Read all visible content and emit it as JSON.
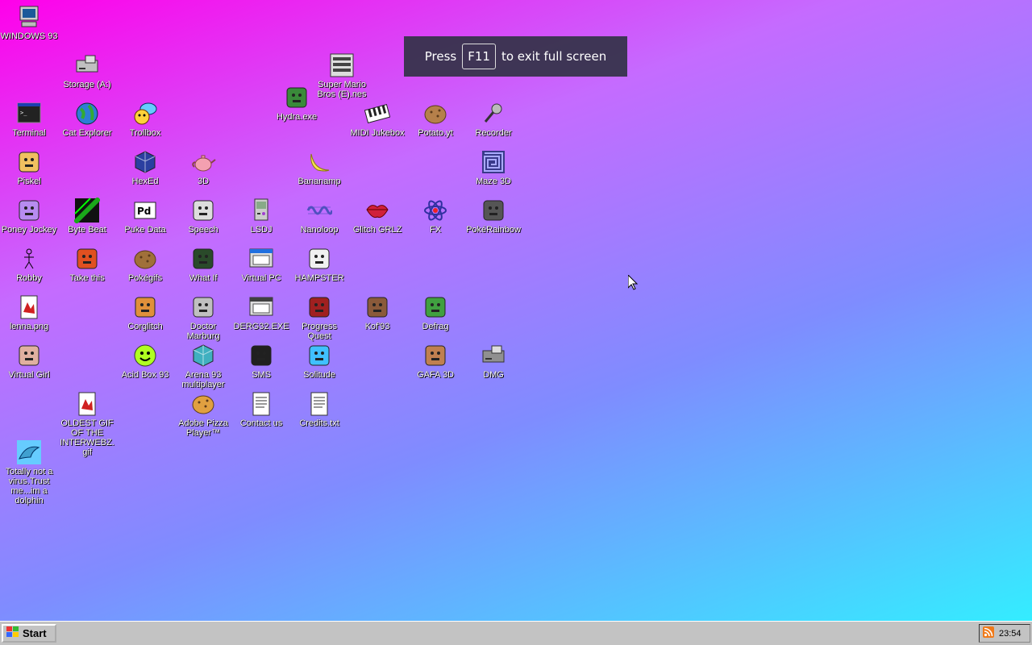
{
  "desktop": {
    "icons": [
      {
        "label": "WINDOWS 93",
        "icon": "computer-icon",
        "color": "#808080"
      },
      {
        "label": "Storage (A:)",
        "icon": "floppy-drive-icon",
        "color": "#c0c0c0"
      },
      {
        "label": "Super Mario Bros (E).nes",
        "icon": "nes-console-icon",
        "color": "#d0d0d0"
      },
      {
        "label": "Hydra.exe",
        "icon": "hydra-icon",
        "color": "#3a8a3a"
      },
      {
        "label": "Terminal",
        "icon": "terminal-icon",
        "color": "#000000"
      },
      {
        "label": "Cat Explorer",
        "icon": "globe-icon",
        "color": "#2e7dd6"
      },
      {
        "label": "Trollbox",
        "icon": "chat-icon",
        "color": "#ffd23a"
      },
      {
        "label": "MIDI Jukebox",
        "icon": "piano-icon",
        "color": "#222222"
      },
      {
        "label": "Potato.yt",
        "icon": "potato-icon",
        "color": "#b5804a"
      },
      {
        "label": "Recorder",
        "icon": "microphone-icon",
        "color": "#888888"
      },
      {
        "label": "Piskel",
        "icon": "palette-icon",
        "color": "#f0c060"
      },
      {
        "label": "HexEd",
        "icon": "cube-icon",
        "color": "#2b3fa0"
      },
      {
        "label": "3D",
        "icon": "teapot-icon",
        "color": "#f3a0b0"
      },
      {
        "label": "Bananamp",
        "icon": "banana-icon",
        "color": "#f5e050"
      },
      {
        "label": "Maze 3D",
        "icon": "maze-icon",
        "color": "#3a3a8a"
      },
      {
        "label": "Poney Jockey",
        "icon": "pony-icon",
        "color": "#b78cf0"
      },
      {
        "label": "Byte Beat",
        "icon": "byte-beat-icon",
        "color": "#1aa81a"
      },
      {
        "label": "Puke Data",
        "icon": "pd-icon",
        "color": "#ffffff"
      },
      {
        "label": "Speech",
        "icon": "face-icon",
        "color": "#dddddd"
      },
      {
        "label": "LSDJ",
        "icon": "gameboy-icon",
        "color": "#a040d0"
      },
      {
        "label": "Nanoloop",
        "icon": "wave-icon",
        "color": "#5050c0"
      },
      {
        "label": "Glitch GRLZ",
        "icon": "lips-icon",
        "color": "#d0203a"
      },
      {
        "label": "FX",
        "icon": "atom-icon",
        "color": "#3030a0"
      },
      {
        "label": "PokéRainbow",
        "icon": "trainers-icon",
        "color": "#555555"
      },
      {
        "label": "Robby",
        "icon": "stick-figure-icon",
        "color": "#000000"
      },
      {
        "label": "Take this",
        "icon": "character-icon",
        "color": "#e05020"
      },
      {
        "label": "Pokégifs",
        "icon": "pokeball-icon",
        "color": "#a0703a"
      },
      {
        "label": "What If",
        "icon": "matrix-icon",
        "color": "#2a4a2a"
      },
      {
        "label": "Virtual PC",
        "icon": "window-icon",
        "color": "#2070e0"
      },
      {
        "label": "HAMPSTER",
        "icon": "hamster-icon",
        "color": "#f0f0f0"
      },
      {
        "label": "lenna.png",
        "icon": "image-file-icon",
        "color": "#d02020"
      },
      {
        "label": "Corglitch",
        "icon": "corgi-icon",
        "color": "#e0903a"
      },
      {
        "label": "Doctor Marburg",
        "icon": "doctor-icon",
        "color": "#c0c0c0"
      },
      {
        "label": "DERG32.EXE",
        "icon": "monitor-face-icon",
        "color": "#404040"
      },
      {
        "label": "Progress Quest",
        "icon": "crossed-swords-icon",
        "color": "#a02020"
      },
      {
        "label": "Kof'93",
        "icon": "fighter-icon",
        "color": "#8a5a3a"
      },
      {
        "label": "Defrag",
        "icon": "defrag-icon",
        "color": "#40a040"
      },
      {
        "label": "Virtual Girl",
        "icon": "portrait-icon",
        "color": "#e0b0a0"
      },
      {
        "label": "Acid Box 93",
        "icon": "smiley-icon",
        "color": "#b0ff20"
      },
      {
        "label": "Arena 93 multiplayer",
        "icon": "arena-cube-icon",
        "color": "#40b0c0"
      },
      {
        "label": "SMS",
        "icon": "sega-console-icon",
        "color": "#202020"
      },
      {
        "label": "Solitude",
        "icon": "bottle-icon",
        "color": "#40c0ff"
      },
      {
        "label": "GAFA 3D",
        "icon": "doom-face-icon",
        "color": "#c08050"
      },
      {
        "label": "DMG",
        "icon": "disk-image-icon",
        "color": "#909090"
      },
      {
        "label": "OLDEST GIF OF THE INTERWEBZ.gif",
        "icon": "gif-file-icon",
        "color": "#d02020"
      },
      {
        "label": "Adobe Pizza Player™",
        "icon": "pizza-icon",
        "color": "#e0a040"
      },
      {
        "label": "Contact us",
        "icon": "letter-icon",
        "color": "#ffffff"
      },
      {
        "label": "Credits.txt",
        "icon": "text-file-icon",
        "color": "#ffffff"
      },
      {
        "label": "Totally not a virus.Trust me...im a dolphin",
        "icon": "dolphin-icon",
        "color": "#40a0d0"
      }
    ]
  },
  "toast": {
    "prefix": "Press",
    "key": "F11",
    "suffix": "to exit full screen"
  },
  "taskbar": {
    "start_label": "Start",
    "clock": "23:54",
    "tray_icon": "rss-icon"
  }
}
